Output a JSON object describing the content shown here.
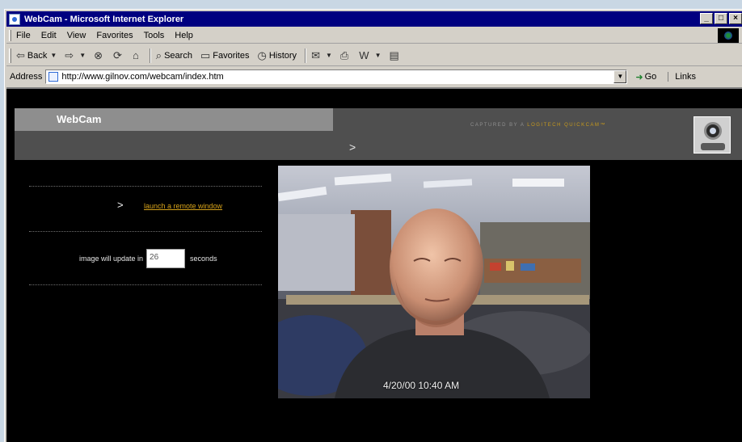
{
  "window": {
    "title": "WebCam - Microsoft Internet Explorer",
    "controls": {
      "minimize": "_",
      "maximize": "□",
      "close": "×"
    }
  },
  "menu": [
    "File",
    "Edit",
    "View",
    "Favorites",
    "Tools",
    "Help"
  ],
  "toolbar": {
    "back": "Back",
    "search": "Search",
    "favorites": "Favorites",
    "history": "History"
  },
  "address": {
    "label": "Address",
    "url": "http://www.gilnov.com/webcam/index.htm",
    "go": "Go",
    "links": "Links"
  },
  "page": {
    "header_title": "WebCam",
    "captured_prefix": "CAPTURED BY A",
    "captured_brand": "LOGITECH QUICKCAM",
    "captured_tm": "™",
    "nav_arrow": ">",
    "launch_arrow": ">",
    "launch_link": "launch a remote window",
    "update_before": "image will update in",
    "seconds_value": "26",
    "update_after": "seconds",
    "timestamp": "4/20/00 10:40 AM"
  }
}
